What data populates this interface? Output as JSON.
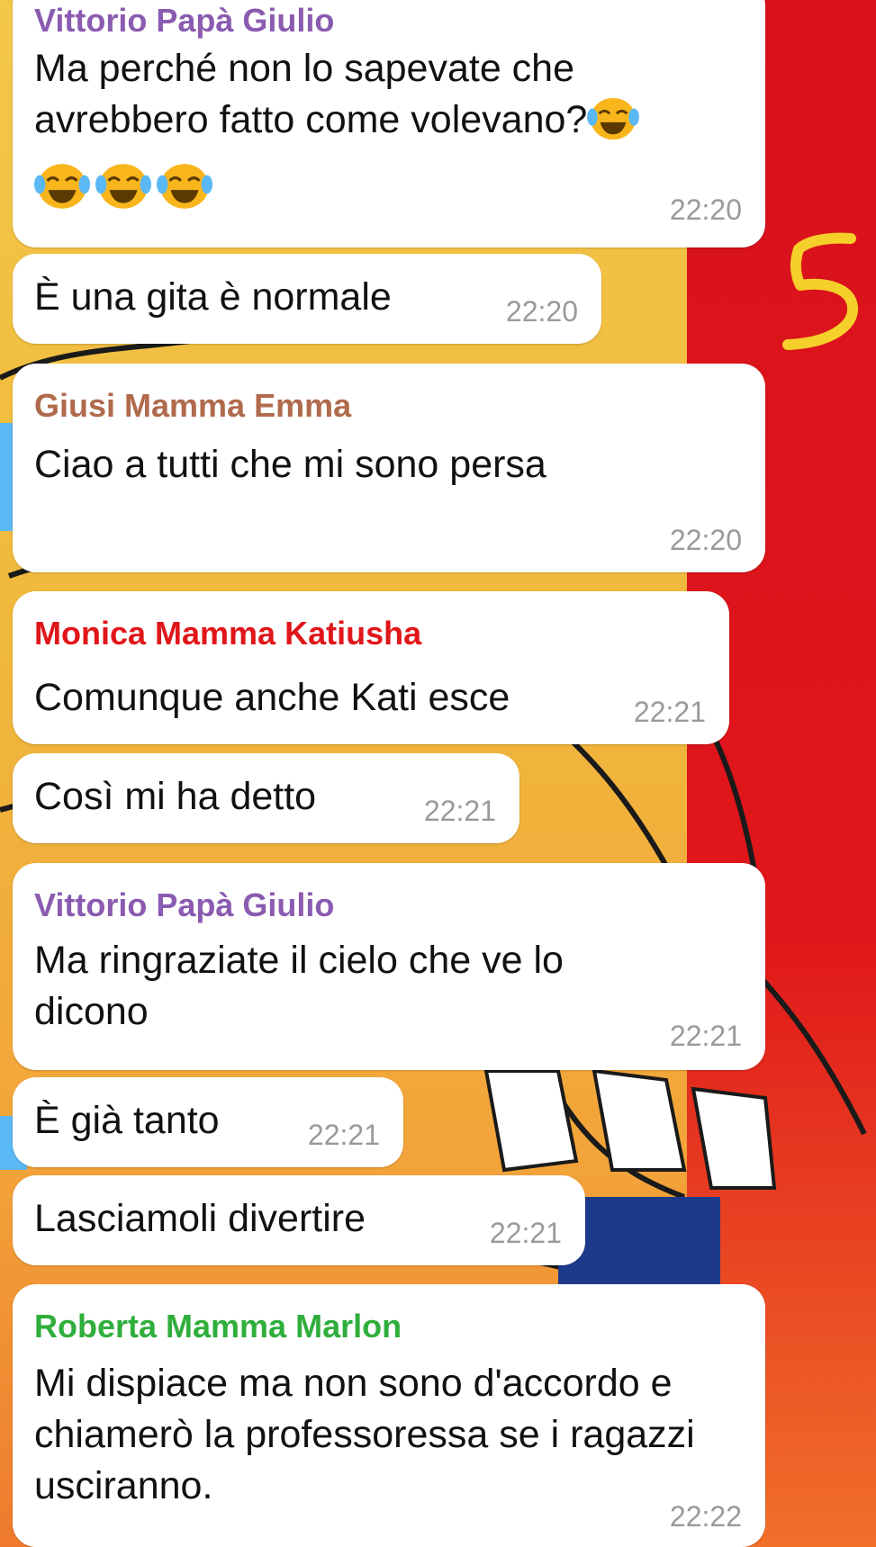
{
  "colors": {
    "sender_purple": "#8a5bb0",
    "sender_brown": "#b06a4c",
    "sender_red": "#e0161a",
    "sender_green": "#2fae3c",
    "timestamp": "#9a9a9a",
    "annotation_yellow": "#f5d02a"
  },
  "annotation": {
    "mark": "5"
  },
  "messages": [
    {
      "sender": "Vittorio Papà Giulio",
      "text_line1": "Ma perché non lo sapevate che",
      "text_line2": "avrebbero fatto come volevano?",
      "emoji": "face-with-tears-of-joy x4",
      "time": "22:20"
    },
    {
      "text": "È una gita è normale",
      "time": "22:20"
    },
    {
      "sender": "Giusi Mamma Emma",
      "text": "Ciao a tutti che mi sono persa",
      "time": "22:20"
    },
    {
      "sender": "Monica Mamma Katiusha",
      "text": "Comunque anche Kati esce",
      "time": "22:21"
    },
    {
      "text": "Così mi ha detto",
      "time": "22:21"
    },
    {
      "sender": "Vittorio Papà Giulio",
      "text": "Ma ringraziate il cielo che ve lo dicono",
      "time": "22:21"
    },
    {
      "text": "È già tanto",
      "time": "22:21"
    },
    {
      "text": "Lasciamoli divertire",
      "time": "22:21"
    },
    {
      "sender": "Roberta Mamma Marlon",
      "text": "Mi dispiace ma non sono d'accordo e chiamerò la professoressa se i ragazzi usciranno.",
      "time": "22:22"
    }
  ]
}
